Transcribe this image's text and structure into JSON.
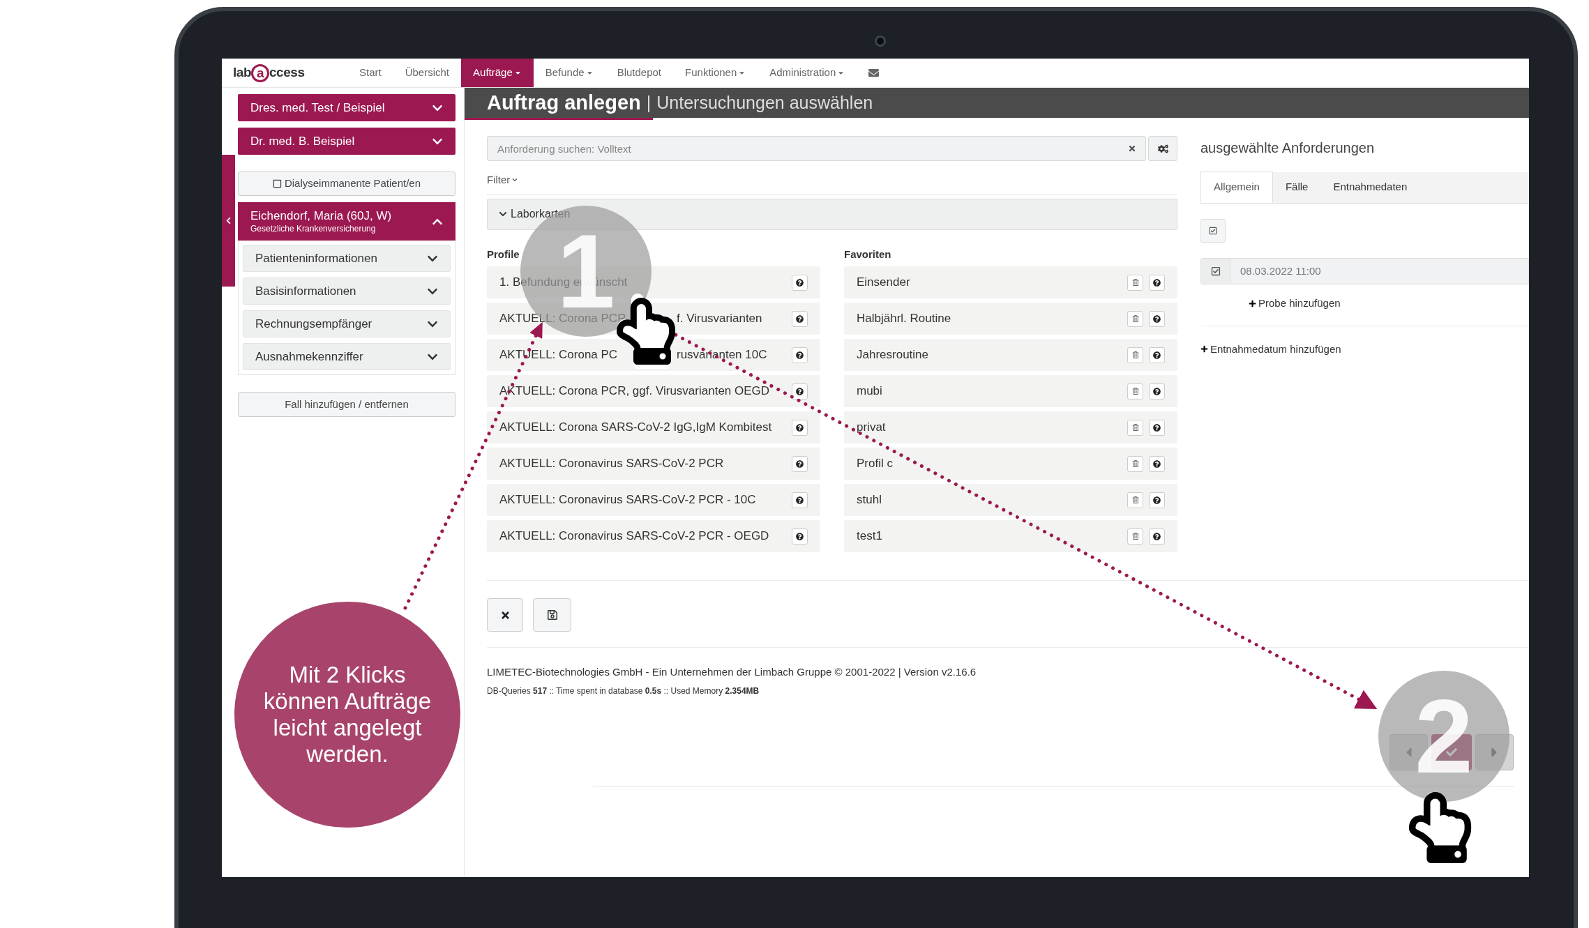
{
  "nav": {
    "logo": [
      "lab",
      "a",
      "ccess"
    ],
    "items": [
      {
        "label": "Start",
        "selected": false,
        "dropdown": false
      },
      {
        "label": "Übersicht",
        "selected": false,
        "dropdown": false
      },
      {
        "label": "Aufträge",
        "selected": true,
        "dropdown": true
      },
      {
        "label": "Befunde",
        "selected": false,
        "dropdown": true
      },
      {
        "label": "Blutdepot",
        "selected": false,
        "dropdown": false
      },
      {
        "label": "Funktionen",
        "selected": false,
        "dropdown": true
      },
      {
        "label": "Administration",
        "selected": false,
        "dropdown": true
      }
    ]
  },
  "sidebar": {
    "doctors": [
      {
        "label": "Dres. med. Test / Beispiel",
        "expanded": false
      },
      {
        "label": "Dr. med. B. Beispiel",
        "expanded": false
      }
    ],
    "dialysis": {
      "label": "Dialyseimmanente Patient/en",
      "checked": false
    },
    "patient": {
      "name": "Eichendorf, Maria (60J, W)",
      "insurance": "Gesetzliche Krankenversicherung",
      "expanded": true
    },
    "sections": [
      {
        "label": "Patienteninformationen",
        "expanded": false
      },
      {
        "label": "Basisinformationen",
        "expanded": false
      },
      {
        "label": "Rechnungsempfänger",
        "expanded": false
      },
      {
        "label": "Ausnahmekennziffer",
        "expanded": false
      }
    ],
    "case_button": "Fall hinzufügen / entfernen"
  },
  "header": {
    "title": "Auftrag anlegen",
    "separator": "|",
    "subtitle": "Untersuchungen auswählen"
  },
  "search": {
    "placeholder": "Anforderung suchen: Volltext"
  },
  "filter": "Filter",
  "lab_cards": {
    "label": "Laborkarten"
  },
  "profiles": {
    "heading": "Profile",
    "items": [
      {
        "text": "1. Befundung erwünscht"
      },
      {
        "text": "AKTUELL: Corona PCR",
        "text_after": "f. Virusvarianten"
      },
      {
        "text": "AKTUELL: Corona PC",
        "text_after": "rusvarianten 10C"
      },
      {
        "text": "AKTUELL: Corona PCR, ggf. Virusvarianten OEGD"
      },
      {
        "text": "AKTUELL: Corona SARS-CoV-2 IgG,IgM Kombitest"
      },
      {
        "text": "AKTUELL: Coronavirus SARS-CoV-2 PCR"
      },
      {
        "text": "AKTUELL: Coronavirus SARS-CoV-2 PCR - 10C"
      },
      {
        "text": "AKTUELL: Coronavirus SARS-CoV-2 PCR - OEGD"
      }
    ]
  },
  "favorites": {
    "heading": "Favoriten",
    "items": [
      "Einsender",
      "Halbjährl. Routine",
      "Jahresroutine",
      "mubi",
      "privat",
      "Profil c",
      "stuhl",
      "test1"
    ]
  },
  "footer": {
    "company": "LIMETEC-Biotechnologies GmbH - Ein Unternehmen der Limbach Gruppe © 2001-2022 | Version v2.16.6",
    "stats": "DB-Queries **517** :: Time spent in database **0.5s** :: Used Memory **2.354MB**"
  },
  "selected_panel": {
    "heading": "ausgewählte Anforderungen",
    "tabs": [
      {
        "label": "Allgemein",
        "selected": true
      },
      {
        "label": "Fälle",
        "selected": false
      },
      {
        "label": "Entnahmedaten",
        "selected": false
      }
    ],
    "date": {
      "value": "08.03.2022 11:00",
      "checked": true
    },
    "add_sample": "Probe hinzufügen",
    "add_date": "Entnahmedatum hinzufügen"
  },
  "callout": {
    "text": "Mit 2 Klicks können Aufträge leicht angelegt werden.",
    "steps": [
      "1",
      "2"
    ]
  }
}
